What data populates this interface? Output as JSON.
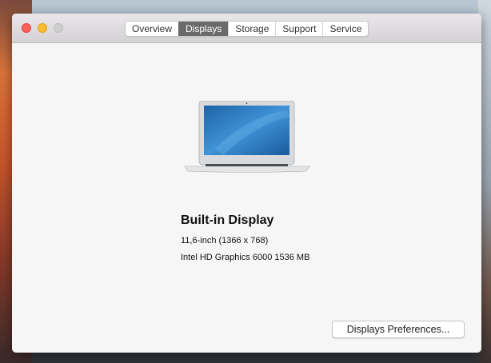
{
  "window": {
    "tabs": [
      "Overview",
      "Displays",
      "Storage",
      "Support",
      "Service"
    ],
    "active_tab": "Displays"
  },
  "display": {
    "name": "Built-in Display",
    "size": "11,6-inch (1366 x 768)",
    "graphics": "Intel HD Graphics 6000 1536 MB"
  },
  "buttons": {
    "preferences": "Displays Preferences..."
  },
  "colors": {
    "close": "#fc5f57",
    "minimize": "#fdbc2e",
    "zoom": "#cfcfcf",
    "active_tab": "#6a6a6a"
  }
}
